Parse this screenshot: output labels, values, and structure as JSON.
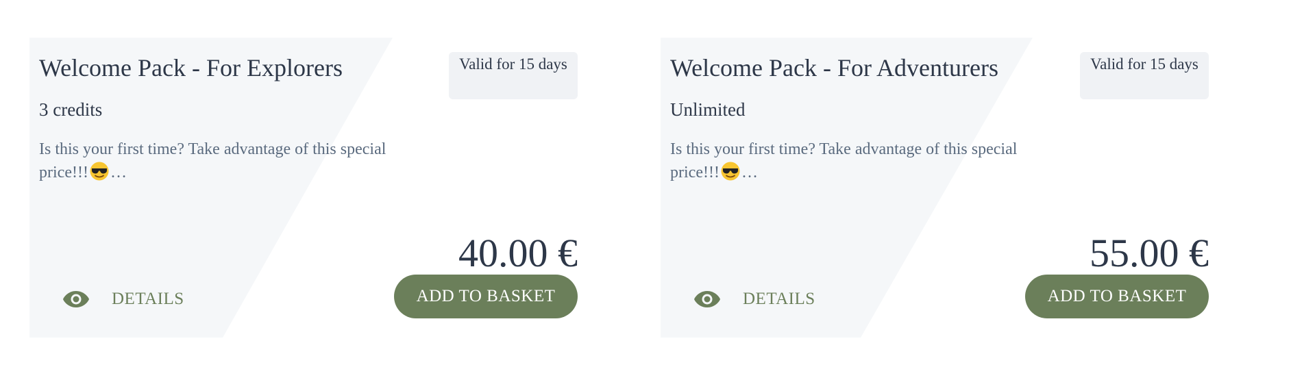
{
  "colors": {
    "card_background": "#f5f7f9",
    "accent": "#6b7f5a",
    "text_primary": "#2d3748",
    "text_muted": "#5a6a7e",
    "badge_background": "#f0f2f5"
  },
  "cards": [
    {
      "title": "Welcome Pack - For Explorers",
      "credits": "3 credits",
      "description_start": "Is this your first time? Take advantage of this special price!!!",
      "description_emoji": "smiling-face-with-sunglasses-icon",
      "description_end": "…",
      "validity": "Valid for 15 days",
      "price": "40.00 €",
      "details_icon": "eye-icon",
      "details_label": "DETAILS",
      "basket_label": "ADD TO BASKET"
    },
    {
      "title": "Welcome Pack - For Adventurers",
      "credits": "Unlimited",
      "description_start": "Is this your first time? Take advantage of this special price!!!",
      "description_emoji": "smiling-face-with-sunglasses-icon",
      "description_end": "…",
      "validity": "Valid for 15 days",
      "price": "55.00 €",
      "details_icon": "eye-icon",
      "details_label": "DETAILS",
      "basket_label": "ADD TO BASKET"
    }
  ]
}
